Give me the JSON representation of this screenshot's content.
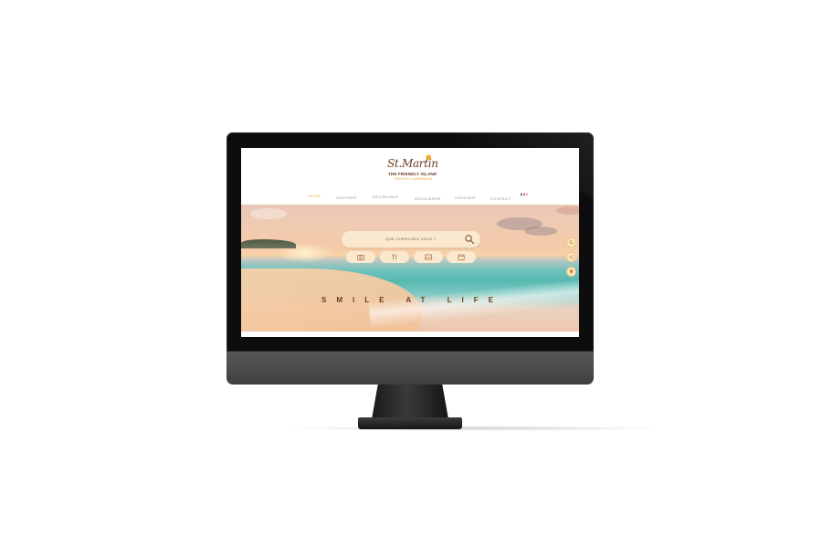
{
  "logo": {
    "script_text": "St.Martin",
    "tagline": "THE FRIENDLY ISLAND",
    "subline": "FRENCH CARIBBEAN"
  },
  "nav": {
    "items": [
      {
        "label": "HOME",
        "active": true
      },
      {
        "label": "INSPIRER",
        "active": false
      },
      {
        "label": "DÉCOUVRIR",
        "active": false
      },
      {
        "label": "SÉJOURNER",
        "active": false
      },
      {
        "label": "VOYAGER",
        "active": false
      },
      {
        "label": "CONTACT",
        "active": false
      }
    ],
    "language": {
      "flag_icon": "france-flag-icon",
      "caret_icon": "chevron-down-icon"
    }
  },
  "search": {
    "placeholder": "QUE CHERCHEZ VOUS ?",
    "icon": "search-icon"
  },
  "categories": [
    {
      "icon": "camera-icon"
    },
    {
      "icon": "restaurant-icon"
    },
    {
      "icon": "bed-icon"
    },
    {
      "icon": "calendar-icon"
    }
  ],
  "hero": {
    "slogan": "SMILE AT LIFE"
  },
  "side_buttons": [
    {
      "icon": "search-icon"
    },
    {
      "icon": "share-icon"
    },
    {
      "icon": "location-icon"
    }
  ],
  "colors": {
    "accent": "#e2a63b",
    "brand_brown": "#6b3a22",
    "pill_bg": "#fbe9cf"
  }
}
